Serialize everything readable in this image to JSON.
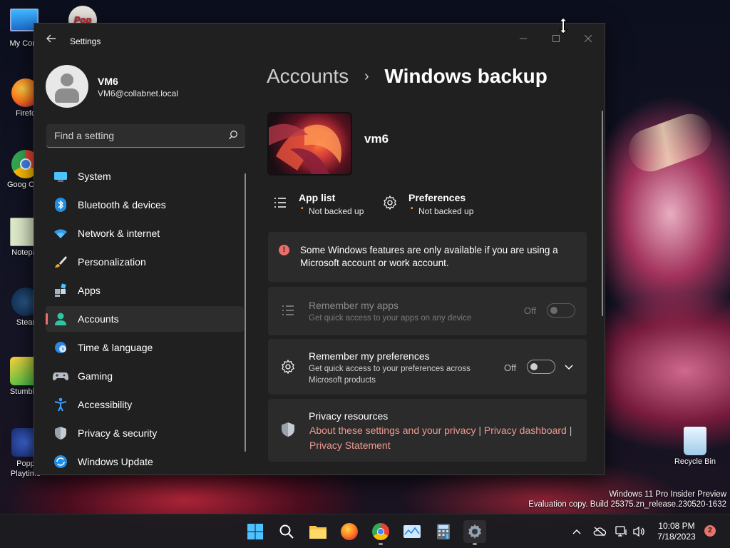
{
  "desktop": {
    "icons": [
      {
        "label": "My Com"
      },
      {
        "label": "Firefo"
      },
      {
        "label": "Goog Chron"
      },
      {
        "label": "Notepa"
      },
      {
        "label": "Stear"
      },
      {
        "label": "Stumble"
      },
      {
        "label": "Popp Playtime"
      }
    ],
    "pop_label": "Pop",
    "recycle_bin": "Recycle Bin",
    "watermark_line1": "Windows 11 Pro Insider Preview",
    "watermark_line2": "Evaluation copy. Build 25375.zn_release.230520-1632"
  },
  "window": {
    "title": "Settings",
    "profile": {
      "name": "VM6",
      "email": "VM6@collabnet.local"
    },
    "search": {
      "placeholder": "Find a setting"
    },
    "nav": [
      {
        "label": "System",
        "icon": "monitor-icon"
      },
      {
        "label": "Bluetooth & devices",
        "icon": "bluetooth-icon"
      },
      {
        "label": "Network & internet",
        "icon": "wifi-icon"
      },
      {
        "label": "Personalization",
        "icon": "brush-icon"
      },
      {
        "label": "Apps",
        "icon": "apps-icon"
      },
      {
        "label": "Accounts",
        "icon": "person-icon",
        "active": true
      },
      {
        "label": "Time & language",
        "icon": "globe-clock-icon"
      },
      {
        "label": "Gaming",
        "icon": "gamepad-icon"
      },
      {
        "label": "Accessibility",
        "icon": "accessibility-icon"
      },
      {
        "label": "Privacy & security",
        "icon": "shield-icon"
      },
      {
        "label": "Windows Update",
        "icon": "update-icon"
      }
    ],
    "breadcrumb": {
      "parent": "Accounts",
      "separator": "›",
      "current": "Windows backup"
    },
    "device_name": "vm6",
    "app_list": {
      "title": "App list",
      "status": "Not backed up"
    },
    "preferences": {
      "title": "Preferences",
      "status": "Not backed up"
    },
    "info": {
      "text": "Some Windows features are only available if you are using a Microsoft account or work account."
    },
    "remember_apps": {
      "title": "Remember my apps",
      "subtitle": "Get quick access to your apps on any device",
      "state": "Off"
    },
    "remember_prefs": {
      "title": "Remember my preferences",
      "subtitle": "Get quick access to your preferences across Microsoft products",
      "state": "Off"
    },
    "privacy": {
      "title": "Privacy resources",
      "link1": "About these settings and your privacy",
      "link2": "Privacy dashboard",
      "link3": "Privacy Statement",
      "divider": "|"
    }
  },
  "taskbar": {
    "time": "10:08 PM",
    "date": "7/18/2023",
    "notifications": "2"
  },
  "colors": {
    "accent": "#e8736d",
    "link": "#f0998e",
    "warning_dot": "#f6b44b",
    "window_bg": "#202020",
    "card_bg": "#2b2b2b"
  }
}
